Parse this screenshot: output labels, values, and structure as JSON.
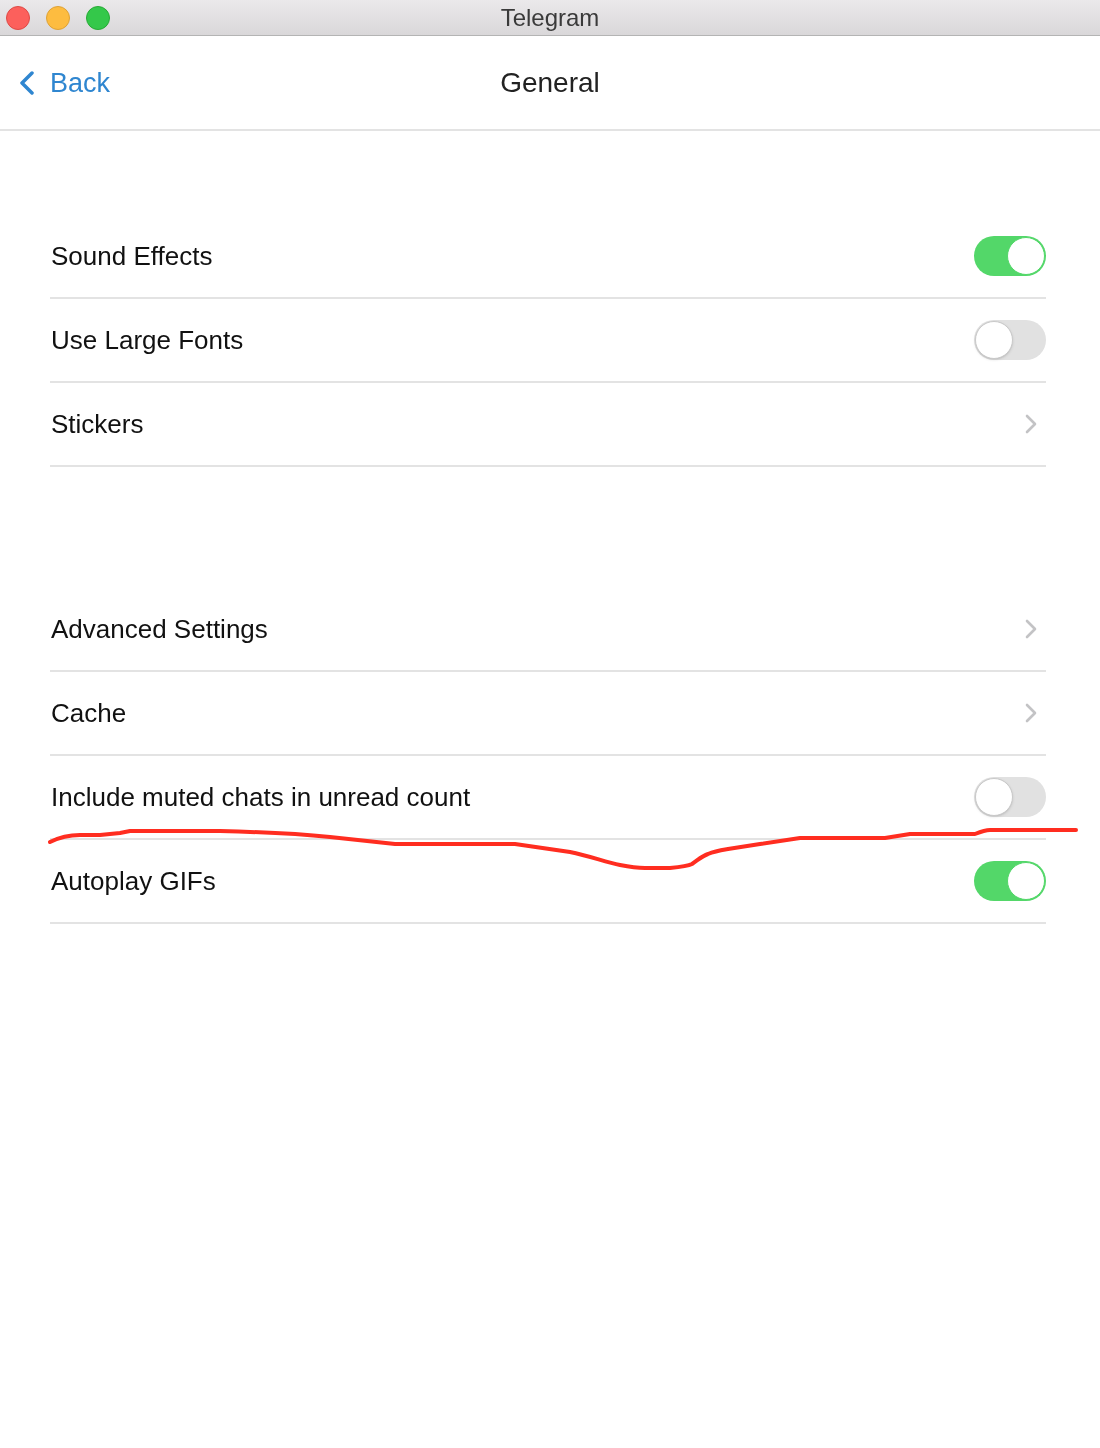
{
  "window": {
    "title": "Telegram"
  },
  "nav": {
    "back": "Back",
    "title": "General"
  },
  "groups": [
    {
      "rows": [
        {
          "kind": "toggle",
          "label": "Sound Effects",
          "on": true
        },
        {
          "kind": "toggle",
          "label": "Use Large Fonts",
          "on": false
        },
        {
          "kind": "disclosure",
          "label": "Stickers"
        }
      ]
    },
    {
      "rows": [
        {
          "kind": "disclosure",
          "label": "Advanced Settings"
        },
        {
          "kind": "disclosure",
          "label": "Cache"
        },
        {
          "kind": "toggle",
          "label": "Include muted chats in unread count",
          "on": false
        },
        {
          "kind": "toggle",
          "label": "Autoplay GIFs",
          "on": true
        }
      ]
    }
  ]
}
